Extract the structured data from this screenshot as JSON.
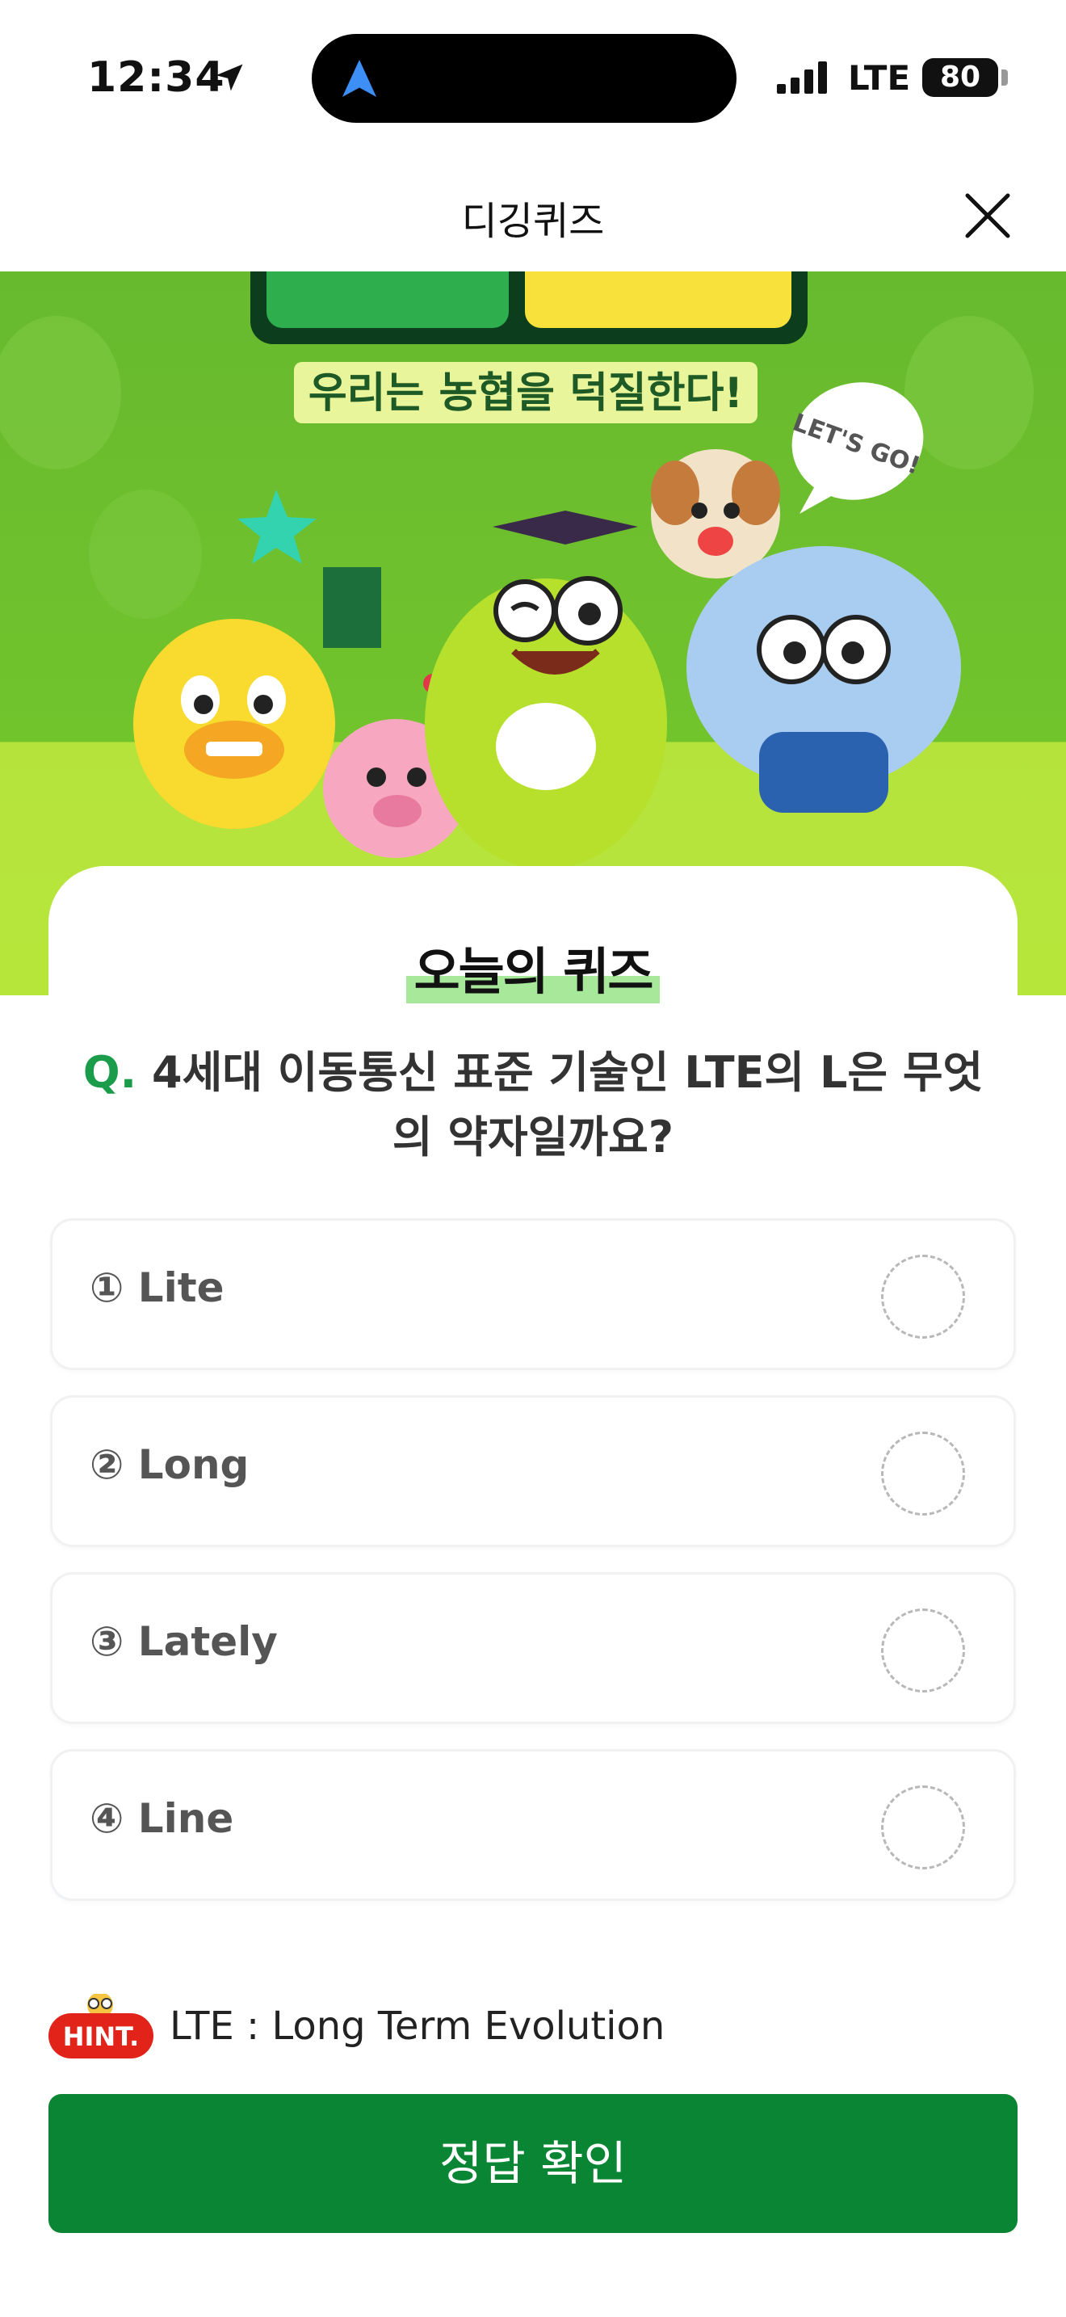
{
  "status_bar": {
    "time": "12:34",
    "network": "LTE",
    "battery": "80"
  },
  "header": {
    "title": "디깅퀴즈",
    "close_icon": "close-icon"
  },
  "banner": {
    "tagline": "우리는 농협을 덕질한다!",
    "bubble": "LET'S GO!"
  },
  "quiz": {
    "badge": "오늘의 퀴즈",
    "q_mark": "Q.",
    "question": "4세대 이동통신 표준 기술인 LTE의 L은 무엇의 약자일까요?",
    "options": [
      {
        "label": "① Lite"
      },
      {
        "label": "② Long"
      },
      {
        "label": "③ Lately"
      },
      {
        "label": "④ Line"
      }
    ],
    "hint_badge": "HINT.",
    "hint": "LTE : Long Term Evolution",
    "submit": "정답 확인"
  },
  "colors": {
    "accent": "#0a8533",
    "banner_green": "#72c42d",
    "lime": "#b7e63b"
  }
}
